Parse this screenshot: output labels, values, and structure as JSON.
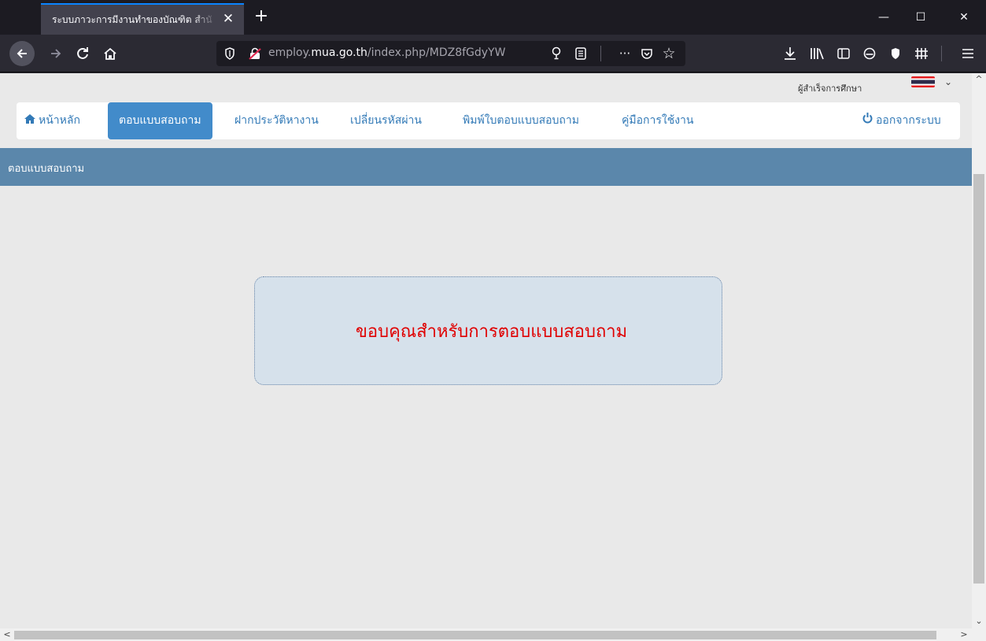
{
  "browser": {
    "tab_title": "ระบบภาวะการมีงานทำของบัณฑิต สำนั",
    "tab_close": "✕",
    "new_tab": "+",
    "url_prefix": "employ.",
    "url_domain": "mua.go.th",
    "url_path": "/index.php/MDZ8fGdyYW",
    "window_controls": {
      "minimize": "—",
      "maximize": "☐",
      "close": "✕"
    },
    "icons": [
      "back-arrow-icon",
      "forward-arrow-icon",
      "reload-icon",
      "home-icon",
      "shield-icon",
      "insecure-lock-icon",
      "lightbulb-icon",
      "reader-view-icon",
      "more-actions-icon",
      "pocket-icon",
      "bookmark-star-icon",
      "download-icon",
      "library-icon",
      "sidebar-icon",
      "account-icon",
      "extension-shield-icon",
      "extension-grid-icon",
      "menu-icon"
    ]
  },
  "header": {
    "subtitle": "ผู้สำเร็จการศึกษา",
    "flag_color": "#2d2a4a"
  },
  "menu": {
    "items": [
      {
        "label": "หน้าหลัก",
        "icon": "home-icon"
      },
      {
        "label": "ตอบแบบสอบถาม",
        "active": true
      },
      {
        "label": "ฝากประวัติหางาน"
      },
      {
        "label": "เปลี่ยนรหัสผ่าน"
      },
      {
        "label": "พิมพ์ใบตอบแบบสอบถาม"
      },
      {
        "label": "คู่มือการใช้งาน"
      }
    ],
    "logout": {
      "label": "ออกจากระบบ",
      "icon": "power-icon"
    },
    "active_color": "#428bca",
    "link_color": "#337ab7"
  },
  "section": {
    "title": "ตอบแบบสอบถาม",
    "bar_color": "#5b87ab"
  },
  "message": {
    "text": "ขอบคุณสำหรับการตอบแบบสอบถาม",
    "color": "#e00000",
    "box_color": "#d6e1eb"
  }
}
